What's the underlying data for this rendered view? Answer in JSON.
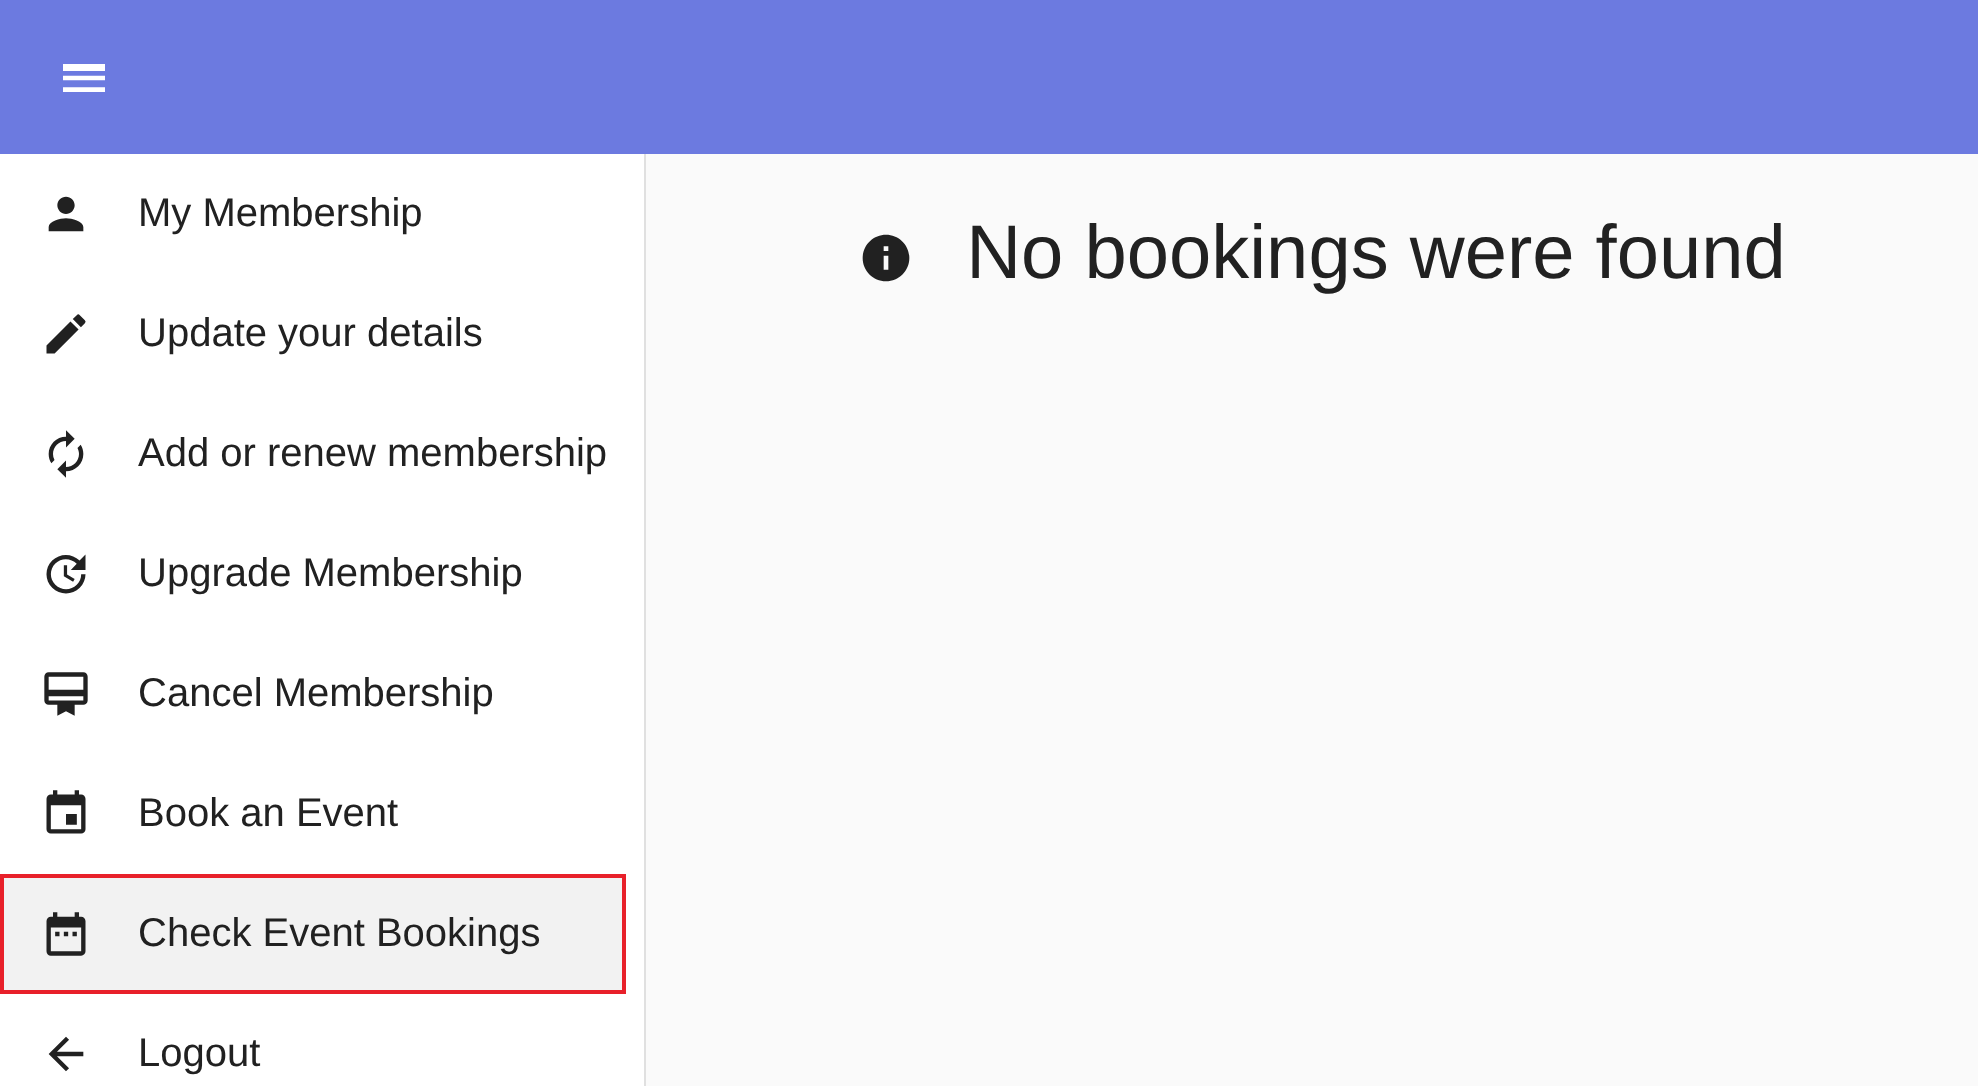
{
  "sidebar": {
    "items": [
      {
        "label": "My Membership",
        "selected": false,
        "highlighted": false
      },
      {
        "label": "Update your details",
        "selected": false,
        "highlighted": false
      },
      {
        "label": "Add or renew membership",
        "selected": false,
        "highlighted": false
      },
      {
        "label": "Upgrade Membership",
        "selected": false,
        "highlighted": false
      },
      {
        "label": "Cancel Membership",
        "selected": false,
        "highlighted": false
      },
      {
        "label": "Book an Event",
        "selected": false,
        "highlighted": false
      },
      {
        "label": "Check Event Bookings",
        "selected": true,
        "highlighted": true
      },
      {
        "label": "Logout",
        "selected": false,
        "highlighted": false
      }
    ]
  },
  "content": {
    "message": "No bookings were found"
  }
}
